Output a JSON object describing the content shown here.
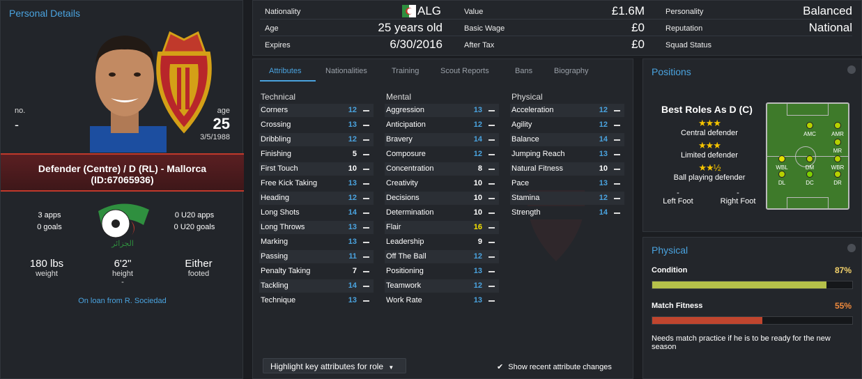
{
  "personal": {
    "title": "Personal Details",
    "no_label": "no.",
    "no_value": "-",
    "age_label": "age",
    "age_value": "25",
    "dob": "3/5/1988",
    "role_line1": "Defender (Centre) / D (RL) - Mallorca",
    "role_line2": "(ID:67065936)",
    "apps": "3 apps",
    "goals": "0 goals",
    "u20_apps": "0 U20 apps",
    "u20_goals": "0 U20 goals",
    "weight": "180 lbs",
    "weight_label": "weight",
    "height": "6'2\"",
    "height_label": "height",
    "height_extra": "-",
    "foot": "Either",
    "foot_label": "footed",
    "loan": "On loan from R. Sociedad",
    "flag_text": "الجزائر"
  },
  "top": {
    "nationality_label": "Nationality",
    "nationality_value": "ALG",
    "age_label": "Age",
    "age_value": "25 years old",
    "expires_label": "Expires",
    "expires_value": "6/30/2016",
    "value_label": "Value",
    "value_value": "£1.6M",
    "wage_label": "Basic Wage",
    "wage_value": "£0",
    "aftertax_label": "After Tax",
    "aftertax_value": "£0",
    "personality_label": "Personality",
    "personality_value": "Balanced",
    "reputation_label": "Reputation",
    "reputation_value": "National",
    "squad_label": "Squad Status",
    "squad_value": ""
  },
  "tabs": [
    "Attributes",
    "Nationalities",
    "Training",
    "Scout Reports",
    "Bans",
    "Biography"
  ],
  "attributes": {
    "technical_title": "Technical",
    "mental_title": "Mental",
    "physical_title": "Physical",
    "technical": [
      {
        "name": "Corners",
        "value": "12"
      },
      {
        "name": "Crossing",
        "value": "13"
      },
      {
        "name": "Dribbling",
        "value": "12"
      },
      {
        "name": "Finishing",
        "value": "5"
      },
      {
        "name": "First Touch",
        "value": "10"
      },
      {
        "name": "Free Kick Taking",
        "value": "13"
      },
      {
        "name": "Heading",
        "value": "12"
      },
      {
        "name": "Long Shots",
        "value": "14"
      },
      {
        "name": "Long Throws",
        "value": "13"
      },
      {
        "name": "Marking",
        "value": "13"
      },
      {
        "name": "Passing",
        "value": "11"
      },
      {
        "name": "Penalty Taking",
        "value": "7"
      },
      {
        "name": "Tackling",
        "value": "14"
      },
      {
        "name": "Technique",
        "value": "13"
      }
    ],
    "mental": [
      {
        "name": "Aggression",
        "value": "13"
      },
      {
        "name": "Anticipation",
        "value": "12"
      },
      {
        "name": "Bravery",
        "value": "14"
      },
      {
        "name": "Composure",
        "value": "12"
      },
      {
        "name": "Concentration",
        "value": "8"
      },
      {
        "name": "Creativity",
        "value": "10"
      },
      {
        "name": "Decisions",
        "value": "10"
      },
      {
        "name": "Determination",
        "value": "10"
      },
      {
        "name": "Flair",
        "value": "16"
      },
      {
        "name": "Leadership",
        "value": "9"
      },
      {
        "name": "Off The Ball",
        "value": "12"
      },
      {
        "name": "Positioning",
        "value": "13"
      },
      {
        "name": "Teamwork",
        "value": "12"
      },
      {
        "name": "Work Rate",
        "value": "13"
      }
    ],
    "physical": [
      {
        "name": "Acceleration",
        "value": "12"
      },
      {
        "name": "Agility",
        "value": "12"
      },
      {
        "name": "Balance",
        "value": "14"
      },
      {
        "name": "Jumping Reach",
        "value": "13"
      },
      {
        "name": "Natural Fitness",
        "value": "10"
      },
      {
        "name": "Pace",
        "value": "13"
      },
      {
        "name": "Stamina",
        "value": "12"
      },
      {
        "name": "Strength",
        "value": "14"
      }
    ],
    "highlight_button": "Highlight key attributes for role",
    "show_recent": "Show recent attribute changes"
  },
  "positions": {
    "title": "Positions",
    "best_roles": "Best Roles As D (C)",
    "roles": [
      {
        "name": "Central defender",
        "stars": 3
      },
      {
        "name": "Limited defender",
        "stars": 3
      },
      {
        "name": "Ball playing defender",
        "stars": 2.5
      }
    ],
    "left_foot_value": "-",
    "left_foot": "Left Foot",
    "right_foot_value": "-",
    "right_foot": "Right Foot",
    "pitch_labels": [
      "AMC",
      "AMR",
      "MR",
      "WBL",
      "DM",
      "WBR",
      "DL",
      "DC",
      "DR"
    ]
  },
  "physical": {
    "title": "Physical",
    "condition_label": "Condition",
    "condition_value": "87%",
    "condition_pct": 87,
    "fitness_label": "Match Fitness",
    "fitness_value": "55%",
    "fitness_pct": 55,
    "note": "Needs match practice if he is to be ready for the new season",
    "colors": {
      "condition": "#b5c04a",
      "fitness": "#c0452e",
      "condition_text": "#f5d36b",
      "fitness_text": "#f08a3c"
    }
  }
}
